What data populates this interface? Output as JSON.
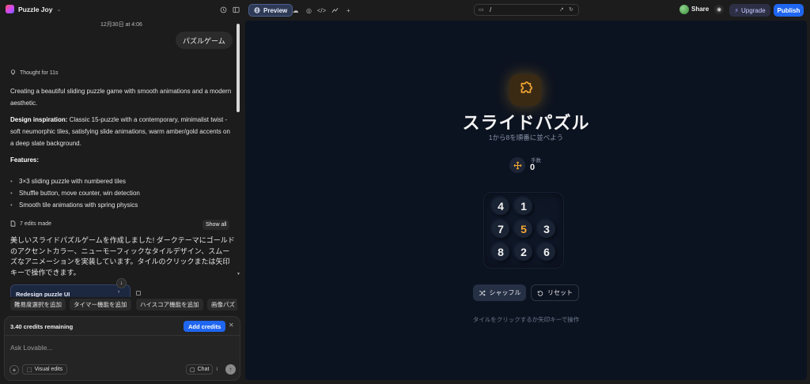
{
  "topbar": {
    "project_name": "Puzzle Joy",
    "preview_label": "Preview",
    "url_path": "/",
    "share_label": "Share",
    "upgrade_label": "Upgrade",
    "publish_label": "Publish"
  },
  "chat": {
    "timestamp": "12月30日 at 4:06",
    "user_message": "パズルゲーム",
    "thought_label": "Thought for 11s",
    "intro": "Creating a beautiful sliding puzzle game with smooth animations and a modern aesthetic.",
    "design_label": "Design inspiration:",
    "design_text": " Classic 15-puzzle with a contemporary, minimalist twist - soft neumorphic tiles, satisfying slide animations, warm amber/gold accents on a deep slate background.",
    "features_label": "Features:",
    "features": [
      "3×3 sliding puzzle with numbered tiles",
      "Shuffle button, move counter, win detection",
      "Smooth tile animations with spring physics"
    ],
    "edits_label": "7 edits made",
    "show_all_label": "Show all",
    "summary_jp": "美しいスライドパズルゲームを作成しました! ダークテーマにゴールドのアクセントカラー、ニューモーフィックなタイルデザイン、スムーズなアニメーションを実装しています。タイルのクリックまたは矢印キーで操作できます。",
    "card_title": "Redesign puzzle UI",
    "suggestions": [
      "難易度選択を追加",
      "タイマー機能を追加",
      "ハイスコア機能を追加",
      "画像パズ"
    ]
  },
  "composer": {
    "credits_text": "3.40 credits remaining",
    "add_credits_label": "Add credits",
    "placeholder": "Ask Lovable...",
    "visual_edits_label": "Visual edits",
    "chat_label": "Chat"
  },
  "preview": {
    "title": "スライドパズル",
    "subtitle": "1から8を順番に並べよう",
    "moves_label": "手数",
    "moves_value": "0",
    "tiles": [
      [
        "4",
        "1",
        ""
      ],
      [
        "7",
        "5",
        "3"
      ],
      [
        "8",
        "2",
        "6"
      ]
    ],
    "accent_tile": "5",
    "shuffle_label": "シャッフル",
    "reset_label": "リセット",
    "hint": "タイルをクリックするか矢印キーで操作"
  },
  "colors": {
    "accent": "#f3a733",
    "background": "#0c1320",
    "tile": "#1a2334",
    "primary_button": "#1f66f0"
  },
  "icons": {
    "brand": "lovable-heart-icon",
    "history": "history-icon",
    "sidebar": "sidebar-toggle-icon",
    "globe": "globe-icon",
    "cloud": "cloud-icon",
    "palette": "palette-icon",
    "code": "code-icon",
    "chart": "analytics-icon",
    "plus": "plus-icon",
    "monitor": "monitor-icon",
    "external": "external-link-icon",
    "refresh": "refresh-icon",
    "github": "github-icon",
    "bolt": "bolt-icon",
    "puzzle": "puzzle-piece-icon",
    "move": "move-arrows-icon",
    "shuffle": "shuffle-icon",
    "reset": "rotate-ccw-icon"
  }
}
